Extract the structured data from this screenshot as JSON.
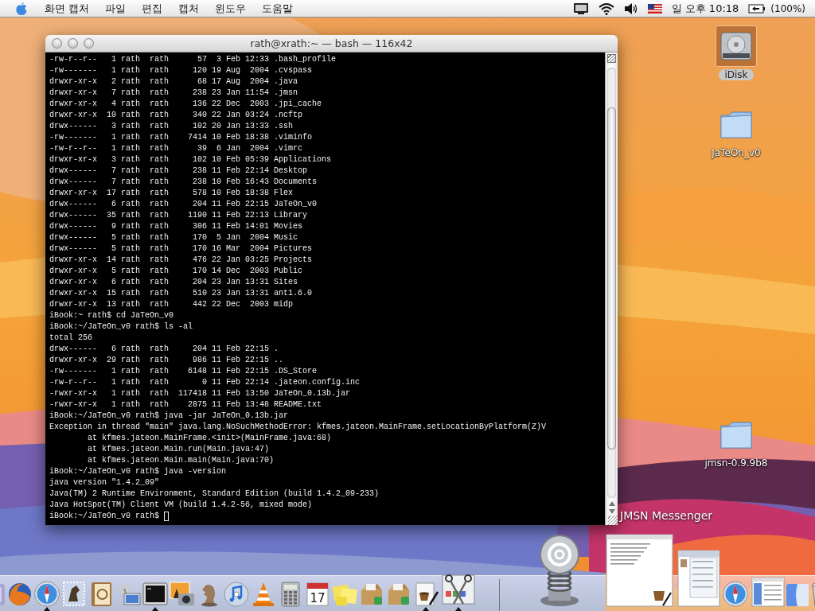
{
  "menu_bar": {
    "menus": [
      "화면 캡처",
      "파일",
      "편집",
      "캡처",
      "윈도우",
      "도움말"
    ],
    "clock": "일 오후 10:18",
    "battery": "(100%)"
  },
  "terminal": {
    "title": "rath@xrath:~ — bash — 116x42",
    "cursor": true,
    "lines": [
      "-rw-r--r--   1 rath  rath      57  3 Feb 12:33 .bash_profile",
      "-rw-------   1 rath  rath     120 19 Aug  2004 .cvspass",
      "drwxr-xr-x   2 rath  rath      68 17 Aug  2004 .java",
      "drwxr-xr-x   7 rath  rath     238 23 Jan 11:54 .jmsn",
      "drwxr-xr-x   4 rath  rath     136 22 Dec  2003 .jpi_cache",
      "drwxr-xr-x  10 rath  rath     340 22 Jan 03:24 .ncftp",
      "drwx------   3 rath  rath     102 20 Jan 13:33 .ssh",
      "-rw-------   1 rath  rath    7414 10 Feb 18:38 .viminfo",
      "-rw-r--r--   1 rath  rath      39  6 Jan  2004 .vimrc",
      "drwxr-xr-x   3 rath  rath     102 10 Feb 05:39 Applications",
      "drwx------   7 rath  rath     238 11 Feb 22:14 Desktop",
      "drwx------   7 rath  rath     238 10 Feb 16:43 Documents",
      "drwxr-xr-x  17 rath  rath     578 10 Feb 18:38 Flex",
      "drwx------   6 rath  rath     204 11 Feb 22:15 JaTeOn_v0",
      "drwx------  35 rath  rath    1190 11 Feb 22:13 Library",
      "drwx------   9 rath  rath     306 11 Feb 14:01 Movies",
      "drwx------   5 rath  rath     170  5 Jan  2004 Music",
      "drwx------   5 rath  rath     170 16 Mar  2004 Pictures",
      "drwxr-xr-x  14 rath  rath     476 22 Jan 03:25 Projects",
      "drwxr-xr-x   5 rath  rath     170 14 Dec  2003 Public",
      "drwxr-xr-x   6 rath  rath     204 23 Jan 13:31 Sites",
      "drwxr-xr-x  15 rath  rath     510 23 Jan 13:31 ant1.6.0",
      "drwxr-xr-x  13 rath  rath     442 22 Dec  2003 midp",
      "iBook:~ rath$ cd JaTeOn_v0",
      "iBook:~/JaTeOn_v0 rath$ ls -al",
      "total 256",
      "drwx------   6 rath  rath     204 11 Feb 22:15 .",
      "drwxr-xr-x  29 rath  rath     986 11 Feb 22:15 ..",
      "-rw-------   1 rath  rath    6148 11 Feb 22:15 .DS_Store",
      "-rw-r--r--   1 rath  rath       0 11 Feb 22:14 .jateon.config.inc",
      "-rwxr-xr-x   1 rath  rath  117418 11 Feb 13:50 JaTeOn_0.13b.jar",
      "-rwxr-xr-x   1 rath  rath    2875 11 Feb 13:48 README.txt",
      "iBook:~/JaTeOn_v0 rath$ java -jar JaTeOn_0.13b.jar",
      "Exception in thread \"main\" java.lang.NoSuchMethodError: kfmes.jateon.MainFrame.setLocationByPlatform(Z)V",
      "\tat kfmes.jateon.MainFrame.<init>(MainFrame.java:68)",
      "\tat kfmes.jateon.Main.run(Main.java:47)",
      "\tat kfmes.jateon.Main.main(Main.java:70)",
      "iBook:~/JaTeOn_v0 rath$ java -version",
      "java version \"1.4.2_09\"",
      "Java(TM) 2 Runtime Environment, Standard Edition (build 1.4.2_09-233)",
      "Java HotSpot(TM) Client VM (build 1.4.2-56, mixed mode)",
      "iBook:~/JaTeOn_v0 rath$"
    ]
  },
  "desktop_icons": [
    {
      "label": "iDisk",
      "kind": "disk",
      "selected": true
    },
    {
      "label": "JaTeOn_v0",
      "kind": "folder",
      "selected": false
    },
    {
      "label": "jmsn-0.9.9b8",
      "kind": "folder",
      "selected": false
    }
  ],
  "dock": {
    "hover_label": "JMSN Messenger",
    "left_items": [
      {
        "kind": "edge"
      },
      {
        "kind": "firefox",
        "running": false
      },
      {
        "kind": "safari",
        "running": true
      },
      {
        "kind": "mail",
        "running": false
      },
      {
        "kind": "addressbook",
        "running": false
      },
      {
        "kind": "network",
        "running": false
      },
      {
        "kind": "terminal",
        "running": true
      },
      {
        "kind": "iphoto",
        "running": false
      },
      {
        "kind": "chess",
        "running": false
      },
      {
        "kind": "itunes",
        "running": false
      },
      {
        "kind": "vlc",
        "running": false
      },
      {
        "kind": "calculator",
        "running": false
      },
      {
        "kind": "ical",
        "running": false,
        "text": "17"
      },
      {
        "kind": "stickies",
        "running": false
      },
      {
        "kind": "package",
        "running": false
      },
      {
        "kind": "package",
        "running": false
      },
      {
        "kind": "scripteditor",
        "running": true
      },
      {
        "kind": "grab",
        "running": true
      }
    ],
    "right_items": [
      {
        "kind": "spring",
        "running": false
      },
      {
        "kind": "messenger-thumb",
        "running": false
      },
      {
        "kind": "browser-thumb",
        "running": false
      },
      {
        "kind": "safari-over",
        "running": false
      },
      {
        "kind": "small-thumb",
        "running": false
      },
      {
        "kind": "finder",
        "running": false
      },
      {
        "kind": "trash"
      }
    ]
  }
}
